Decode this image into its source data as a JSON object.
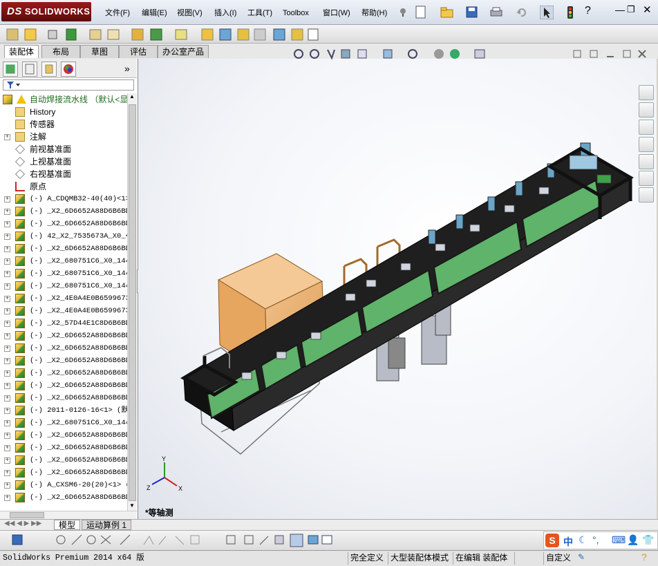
{
  "app": {
    "brand": "SOLIDWORKS",
    "brand_prefix": "DS"
  },
  "menu": [
    "文件(F)",
    "编辑(E)",
    "视图(V)",
    "插入(I)",
    "工具(T)",
    "Toolbox",
    "窗口(W)",
    "帮助(H)"
  ],
  "command_tabs": [
    {
      "label": "装配体",
      "active": true
    },
    {
      "label": "布局",
      "active": false
    },
    {
      "label": "草图",
      "active": false
    },
    {
      "label": "评估",
      "active": false
    },
    {
      "label": "办公室产品",
      "active": false
    }
  ],
  "feature_tree": {
    "expand_label": "»",
    "root": {
      "label": "自动焊接流水线 （默认<显",
      "icon": "assembly-warning-icon"
    },
    "items": [
      {
        "label": "History",
        "icon": "history-icon",
        "expander": false
      },
      {
        "label": "传感器",
        "icon": "sensor-icon",
        "expander": false
      },
      {
        "label": "注解",
        "icon": "annotation-icon",
        "expander": true
      },
      {
        "label": "前视基准面",
        "icon": "plane-icon",
        "expander": false
      },
      {
        "label": "上视基准面",
        "icon": "plane-icon",
        "expander": false
      },
      {
        "label": "右视基准面",
        "icon": "plane-icon",
        "expander": false
      },
      {
        "label": "原点",
        "icon": "origin-icon",
        "expander": false
      },
      {
        "label": "(-) A_CDQMB32-40(40)<1>",
        "icon": "part-icon",
        "expander": true
      },
      {
        "label": "(-) _X2_6D6652A88D6B6BD",
        "icon": "part-icon",
        "expander": true
      },
      {
        "label": "(-) _X2_6D6652A88D6B6BD",
        "icon": "part-icon",
        "expander": true
      },
      {
        "label": "(-) 42_X2_7535673A_X0_<",
        "icon": "part-icon",
        "expander": true
      },
      {
        "label": "(-) _X2_6D6652A88D6B6BD",
        "icon": "part-icon",
        "expander": true
      },
      {
        "label": "(-) _X2_680751C6_X0_144",
        "icon": "part-icon",
        "expander": true
      },
      {
        "label": "(-) _X2_680751C6_X0_144",
        "icon": "part-icon",
        "expander": true
      },
      {
        "label": "(-) _X2_680751C6_X0_144",
        "icon": "part-icon",
        "expander": true
      },
      {
        "label": "(-) _X2_4E0A4E0B6599673",
        "icon": "part-icon",
        "expander": true
      },
      {
        "label": "(-) _X2_4E0A4E0B6599673",
        "icon": "part-icon",
        "expander": true
      },
      {
        "label": "(-) _X2_57D44E1C8D6B6BD",
        "icon": "part-icon",
        "expander": true
      },
      {
        "label": "(-) _X2_6D6652A88D6B6BD",
        "icon": "part-icon",
        "expander": true
      },
      {
        "label": "(-) _X2_6D6652A88D6B6BD",
        "icon": "part-icon",
        "expander": true
      },
      {
        "label": "(-) _X2_6D6652A88D6B6BD",
        "icon": "part-icon",
        "expander": true
      },
      {
        "label": "(-) _X2_6D6652A88D6B6BD",
        "icon": "part-icon",
        "expander": true
      },
      {
        "label": "(-) _X2_6D6652A88D6B6BD",
        "icon": "part-icon",
        "expander": true
      },
      {
        "label": "(-) _X2_6D6652A88D6B6BD",
        "icon": "part-icon",
        "expander": true
      },
      {
        "label": "(-) 2011-0126-16<1> (默",
        "icon": "part-icon",
        "expander": true
      },
      {
        "label": "(-) _X2_680751C6_X0_144",
        "icon": "part-icon",
        "expander": true
      },
      {
        "label": "(-) _X2_6D6652A88D6B6BD",
        "icon": "part-icon",
        "expander": true
      },
      {
        "label": "(-) _X2_6D6652A88D6B6BD",
        "icon": "part-icon",
        "expander": true
      },
      {
        "label": "(-) _X2_6D6652A88D6B6BD",
        "icon": "part-icon",
        "expander": true
      },
      {
        "label": "(-) _X2_6D6652A88D6B6BD",
        "icon": "part-icon",
        "expander": true
      },
      {
        "label": "(-) A_CXSM6-20(20)<1> (",
        "icon": "part-icon",
        "expander": true
      },
      {
        "label": "(-) _X2_6D6652A88D6B6BD",
        "icon": "part-icon",
        "expander": true
      }
    ]
  },
  "view": {
    "orientation_label": "*等轴测",
    "axis_labels": {
      "x": "X",
      "y": "Y",
      "z": "Z"
    }
  },
  "bottom_tabs": [
    {
      "label": "模型",
      "active": true
    },
    {
      "label": "运动算例 1",
      "active": false
    }
  ],
  "status": {
    "version": "SolidWorks Premium 2014 x64 版",
    "cells": [
      "完全定义",
      "大型装配体模式",
      "在编辑 装配体"
    ],
    "ime_label": "中",
    "custom_label": "自定义"
  },
  "colors": {
    "conveyor_green": "#5fb36a",
    "frame_black": "#1a1a1a",
    "box_tan": "#e4a35c",
    "brand_red": "#8b1414"
  }
}
